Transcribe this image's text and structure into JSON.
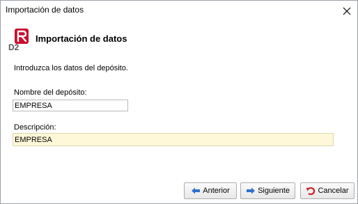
{
  "window": {
    "title": "Importación de datos"
  },
  "header": {
    "title": "Importación de datos",
    "logo_text": "D2"
  },
  "intro": "Introduzca los datos del depósito.",
  "form": {
    "name_label": "Nombre del depósito:",
    "name_value": "EMPRESA",
    "description_label": "Descripción:",
    "description_value": "EMPRESA"
  },
  "buttons": {
    "previous": "Anterior",
    "next": "Siguiente",
    "cancel": "Cancelar"
  },
  "colors": {
    "logo_red": "#c8102e",
    "description_bg": "#fff8d8",
    "arrow_blue": "#2f6fd0",
    "cancel_red": "#d0202a"
  }
}
